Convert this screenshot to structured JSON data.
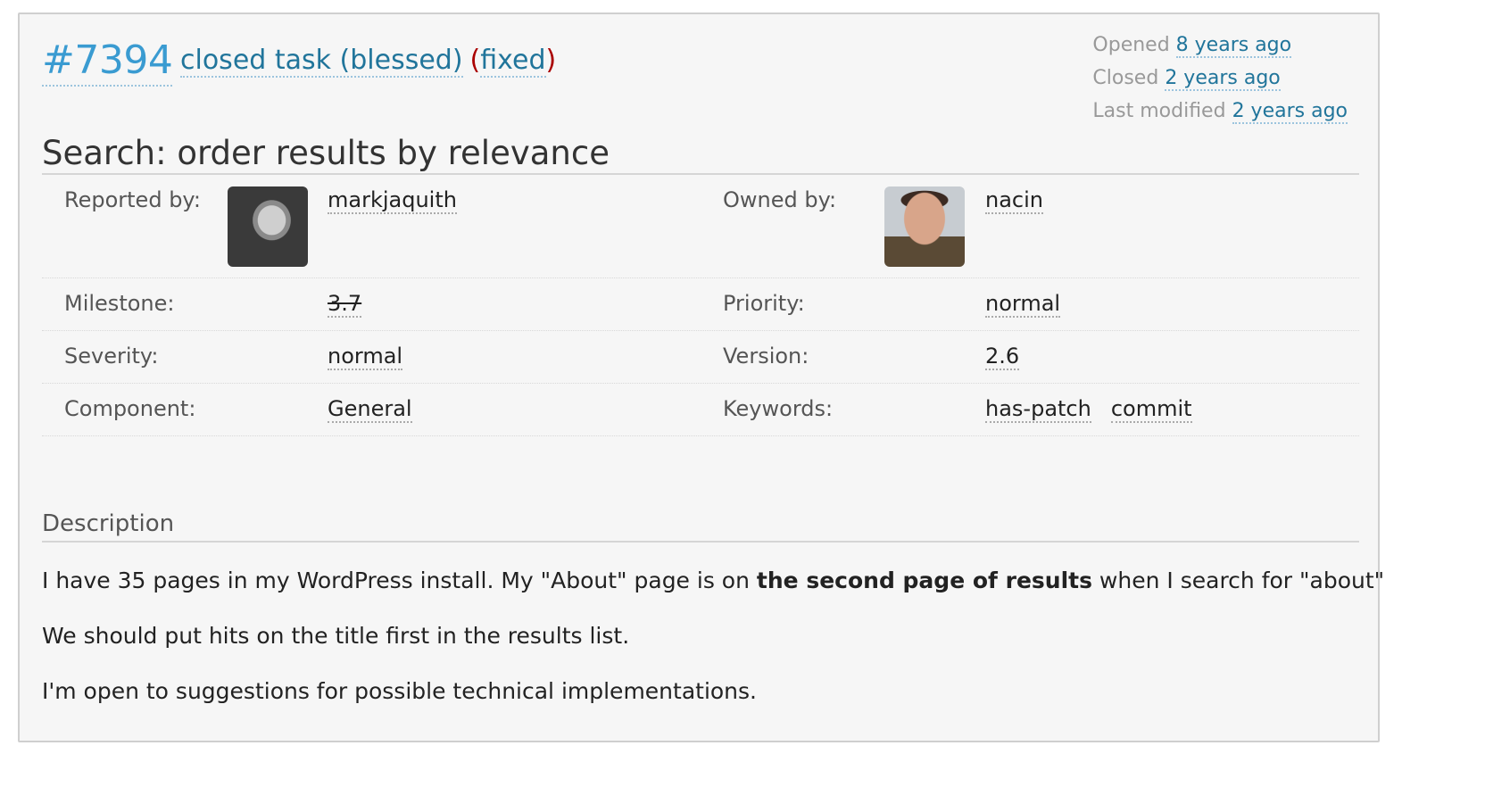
{
  "ticket": {
    "id": "#7394",
    "type_label": "closed task (blessed)",
    "resolution": "fixed",
    "summary": "Search: order results by relevance"
  },
  "dates": {
    "opened_label": "Opened",
    "opened_value": "8 years ago",
    "closed_label": "Closed",
    "closed_value": "2 years ago",
    "modified_label": "Last modified",
    "modified_value": "2 years ago"
  },
  "properties": {
    "reported_by_label": "Reported by:",
    "reporter": "markjaquith",
    "owned_by_label": "Owned by:",
    "owner": "nacin",
    "milestone_label": "Milestone:",
    "milestone": "3.7",
    "priority_label": "Priority:",
    "priority": "normal",
    "severity_label": "Severity:",
    "severity": "normal",
    "version_label": "Version:",
    "version": "2.6",
    "component_label": "Component:",
    "component": "General",
    "keywords_label": "Keywords:",
    "keywords": [
      "has-patch",
      "commit"
    ]
  },
  "description": {
    "heading": "Description",
    "p1_before": "I have 35 pages in my WordPress install. My \"About\" page is on ",
    "p1_bold": "the second page of results",
    "p1_after": " when I search for \"about\"",
    "p2": "We should put hits on the title first in the results list.",
    "p3": "I'm open to suggestions for possible technical implementations."
  },
  "colors": {
    "link": "#21759b",
    "ticket_id": "#3a9bd1",
    "resolution_paren": "#aa0000"
  }
}
